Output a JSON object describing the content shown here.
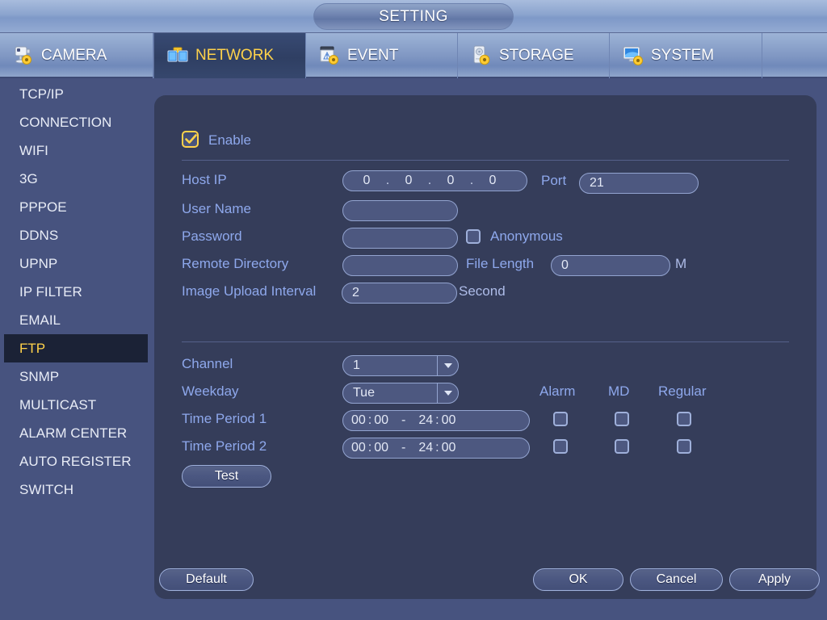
{
  "window": {
    "title": "SETTING"
  },
  "tabs": [
    {
      "label": "CAMERA",
      "icon": "camera-gear-icon",
      "active": false
    },
    {
      "label": "NETWORK",
      "icon": "network-monitors-icon",
      "active": true
    },
    {
      "label": "EVENT",
      "icon": "event-gear-icon",
      "active": false
    },
    {
      "label": "STORAGE",
      "icon": "harddisk-gear-icon",
      "active": false
    },
    {
      "label": "SYSTEM",
      "icon": "monitor-gear-icon",
      "active": false
    }
  ],
  "sidebar": {
    "items": [
      {
        "label": "TCP/IP",
        "active": false
      },
      {
        "label": "CONNECTION",
        "active": false
      },
      {
        "label": "WIFI",
        "active": false
      },
      {
        "label": "3G",
        "active": false
      },
      {
        "label": "PPPOE",
        "active": false
      },
      {
        "label": "DDNS",
        "active": false
      },
      {
        "label": "UPNP",
        "active": false
      },
      {
        "label": "IP FILTER",
        "active": false
      },
      {
        "label": "EMAIL",
        "active": false
      },
      {
        "label": "FTP",
        "active": true
      },
      {
        "label": "SNMP",
        "active": false
      },
      {
        "label": "MULTICAST",
        "active": false
      },
      {
        "label": "ALARM CENTER",
        "active": false
      },
      {
        "label": "AUTO REGISTER",
        "active": false
      },
      {
        "label": "SWITCH",
        "active": false
      }
    ]
  },
  "form": {
    "enable": {
      "label": "Enable",
      "checked": true
    },
    "host_ip": {
      "label": "Host IP",
      "octet1": "0",
      "octet2": "0",
      "octet3": "0",
      "octet4": "0"
    },
    "port": {
      "label": "Port",
      "value": "21"
    },
    "user_name": {
      "label": "User Name",
      "value": ""
    },
    "password": {
      "label": "Password",
      "value": ""
    },
    "anonymous": {
      "label": "Anonymous",
      "checked": false
    },
    "remote_directory": {
      "label": "Remote Directory",
      "value": ""
    },
    "file_length": {
      "label": "File Length",
      "value": "0",
      "unit": "M"
    },
    "image_upload_interval": {
      "label": "Image Upload Interval",
      "value": "2",
      "unit": "Second"
    }
  },
  "schedule": {
    "channel": {
      "label": "Channel",
      "value": "1"
    },
    "weekday": {
      "label": "Weekday",
      "value": "Tue"
    },
    "columns": {
      "alarm": "Alarm",
      "md": "MD",
      "regular": "Regular"
    },
    "periods": [
      {
        "label": "Time Period 1",
        "start_hour": "00",
        "start_min": "00",
        "dash": "-",
        "end_hour": "24",
        "end_min": "00",
        "alarm": false,
        "md": false,
        "regular": false
      },
      {
        "label": "Time Period 2",
        "start_hour": "00",
        "start_min": "00",
        "dash": "-",
        "end_hour": "24",
        "end_min": "00",
        "alarm": false,
        "md": false,
        "regular": false
      }
    ],
    "test_button": "Test"
  },
  "footer": {
    "default_label": "Default",
    "ok_label": "OK",
    "cancel_label": "Cancel",
    "apply_label": "Apply"
  },
  "colors": {
    "desktop_bg": "#47537f",
    "panel_bg": "#353d5a",
    "accent_yellow": "#ffd24a",
    "label_blue": "#8ea8ec",
    "field_bg": "#4d5880",
    "field_border": "#93a4d0",
    "active_sidebar_bg": "#1b2236"
  }
}
